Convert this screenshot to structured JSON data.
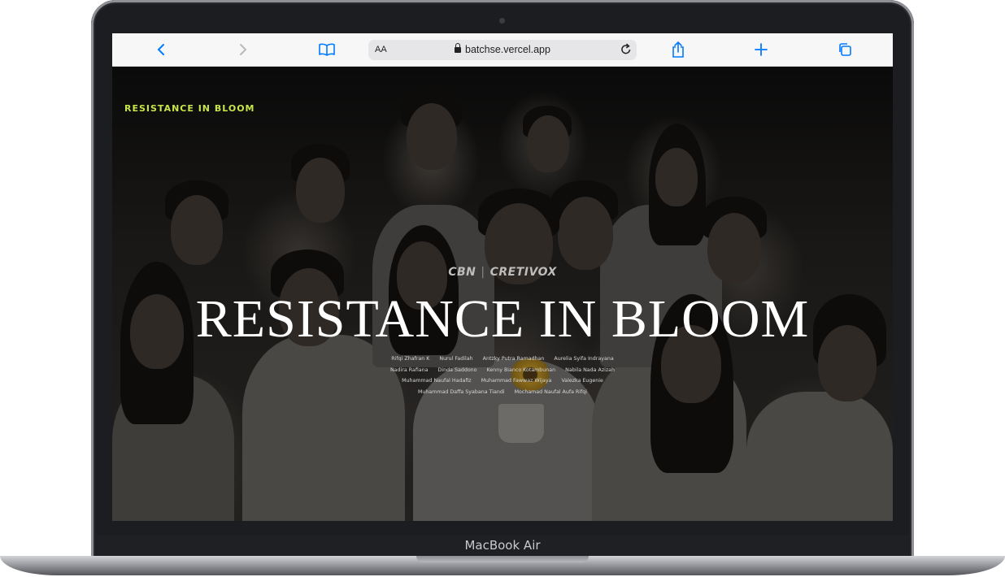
{
  "device": {
    "label": "MacBook Air"
  },
  "browser": {
    "text_size_label": "AA",
    "url": "batchse.vercel.app",
    "icons": {
      "back": "chevron-left-icon",
      "forward": "chevron-right-icon",
      "bookmarks": "book-icon",
      "share": "share-icon",
      "new_tab": "plus-icon",
      "tabs": "tabs-icon",
      "reload": "reload-icon",
      "lock": "lock-icon"
    },
    "accent_color": "#007aff"
  },
  "page": {
    "logo_text": "RESISTANCE IN BLOOM",
    "logo_color": "#c8e64a",
    "sponsor": {
      "left": "CBN",
      "right": "CRETIVOX"
    },
    "title": "RESISTANCE IN BLOOM",
    "credits": [
      [
        "Rifqi Zhafran K",
        "Nurul Fadilah",
        "Antzky Putra Ramadhan",
        "Aurelia Syifa Indrayana"
      ],
      [
        "Nadira Rafiana",
        "Dinda Saddono",
        "Kenny Bianco Kotambunan",
        "Nabila Nada Azizah"
      ],
      [
        "Muhammad Naufal Hadafiz",
        "Muhammad Fawwaz Wijaya",
        "Valezka Eugenie"
      ],
      [
        "Muhammad Daffa Syabana Tiandi",
        "Mochamad Naufal Aufa Rifqi"
      ]
    ],
    "dock": [
      {
        "icon": "home-icon"
      },
      {
        "icon": "video-icon"
      },
      {
        "icon": "gallery-icon"
      },
      {
        "icon": "youtube-icon"
      },
      {
        "icon": "smile-icon"
      },
      {
        "icon": "user-icon"
      }
    ]
  }
}
